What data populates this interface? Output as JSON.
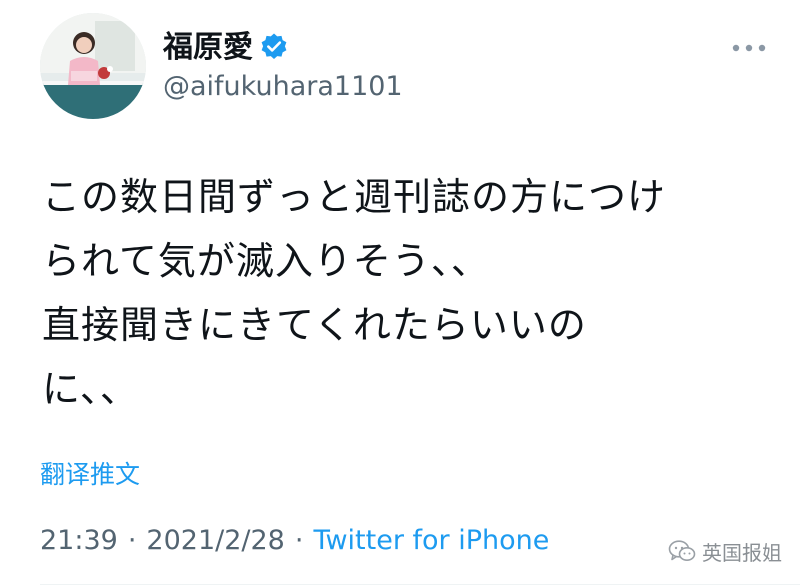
{
  "user": {
    "display_name": "福原愛",
    "handle": "@aifukuhara1101",
    "verified": true
  },
  "tweet": {
    "text": "この数日間ずっと週刊誌の方につけ\nられて気が滅入りそう、、\n直接聞きにきてくれたらいいの\nに、、",
    "translate_label": "翻译推文",
    "time": "21:39",
    "date": "2021/2/28",
    "source": "Twitter for iPhone",
    "separator": "·"
  },
  "watermark": {
    "text": "英国报姐"
  },
  "colors": {
    "accent": "#1d9bf0",
    "muted": "#536471",
    "text": "#0f1419"
  },
  "icons": [
    "verified-badge-icon",
    "more-options-icon",
    "wechat-icon"
  ]
}
